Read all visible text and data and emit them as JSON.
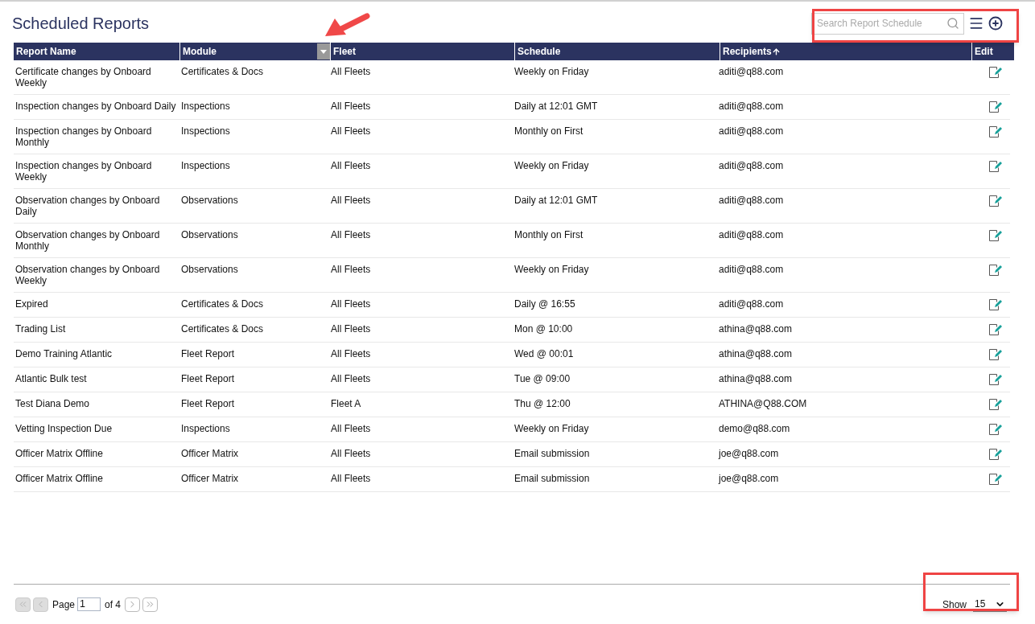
{
  "page": {
    "title": "Scheduled Reports"
  },
  "search": {
    "placeholder": "Search Report Schedule"
  },
  "table": {
    "columns": [
      {
        "label": "Report Name",
        "sorted": false,
        "filter_menu": false
      },
      {
        "label": "Module",
        "sorted": false,
        "filter_menu": true
      },
      {
        "label": "Fleet",
        "sorted": false,
        "filter_menu": false
      },
      {
        "label": "Schedule",
        "sorted": false,
        "filter_menu": false
      },
      {
        "label": "Recipients",
        "sorted": true,
        "filter_menu": false
      },
      {
        "label": "Edit",
        "sorted": false,
        "filter_menu": false
      }
    ],
    "rows": [
      {
        "name": "Certificate changes by Onboard Weekly",
        "module": "Certificates & Docs",
        "fleet": "All Fleets",
        "schedule": "Weekly on Friday",
        "recipients": "aditi@q88.com"
      },
      {
        "name": "Inspection changes by Onboard Daily",
        "module": "Inspections",
        "fleet": "All Fleets",
        "schedule": "Daily at 12:01 GMT",
        "recipients": "aditi@q88.com"
      },
      {
        "name": "Inspection changes by Onboard Monthly",
        "module": "Inspections",
        "fleet": "All Fleets",
        "schedule": "Monthly on First",
        "recipients": "aditi@q88.com"
      },
      {
        "name": "Inspection changes by Onboard Weekly",
        "module": "Inspections",
        "fleet": "All Fleets",
        "schedule": "Weekly on Friday",
        "recipients": "aditi@q88.com"
      },
      {
        "name": "Observation changes by Onboard Daily",
        "module": "Observations",
        "fleet": "All Fleets",
        "schedule": "Daily at 12:01 GMT",
        "recipients": "aditi@q88.com"
      },
      {
        "name": "Observation changes by Onboard Monthly",
        "module": "Observations",
        "fleet": "All Fleets",
        "schedule": "Monthly on First",
        "recipients": "aditi@q88.com"
      },
      {
        "name": "Observation changes by Onboard Weekly",
        "module": "Observations",
        "fleet": "All Fleets",
        "schedule": "Weekly on Friday",
        "recipients": "aditi@q88.com"
      },
      {
        "name": "Expired",
        "module": "Certificates & Docs",
        "fleet": "All Fleets",
        "schedule": "Daily @ 16:55",
        "recipients": "aditi@q88.com"
      },
      {
        "name": "Trading List",
        "module": "Certificates & Docs",
        "fleet": "All Fleets",
        "schedule": "Mon @ 10:00",
        "recipients": "athina@q88.com"
      },
      {
        "name": "Demo Training Atlantic",
        "module": "Fleet Report",
        "fleet": "All Fleets",
        "schedule": "Wed @ 00:01",
        "recipients": "athina@q88.com"
      },
      {
        "name": "Atlantic Bulk test",
        "module": "Fleet Report",
        "fleet": "All Fleets",
        "schedule": "Tue @ 09:00",
        "recipients": "athina@q88.com"
      },
      {
        "name": "Test Diana Demo",
        "module": "Fleet Report",
        "fleet": "Fleet A",
        "schedule": "Thu @ 12:00",
        "recipients": "ATHINA@Q88.COM"
      },
      {
        "name": "Vetting Inspection Due",
        "module": "Inspections",
        "fleet": "All Fleets",
        "schedule": "Weekly on Friday",
        "recipients": "demo@q88.com"
      },
      {
        "name": "Officer Matrix Offline",
        "module": "Officer Matrix",
        "fleet": "All Fleets",
        "schedule": "Email submission",
        "recipients": "joe@q88.com"
      },
      {
        "name": "Officer Matrix Offline",
        "module": "Officer Matrix",
        "fleet": "All Fleets",
        "schedule": "Email submission",
        "recipients": "joe@q88.com"
      }
    ]
  },
  "pagination": {
    "buttons": [
      {
        "kind": "first",
        "disabled": true
      },
      {
        "kind": "prev",
        "disabled": true
      }
    ],
    "page_label": "Page",
    "page_value": "1",
    "of_label": "of 4",
    "next_buttons": [
      {
        "kind": "next",
        "disabled": false
      },
      {
        "kind": "last",
        "disabled": false
      }
    ],
    "show_label": "Show",
    "show_value": "15"
  }
}
